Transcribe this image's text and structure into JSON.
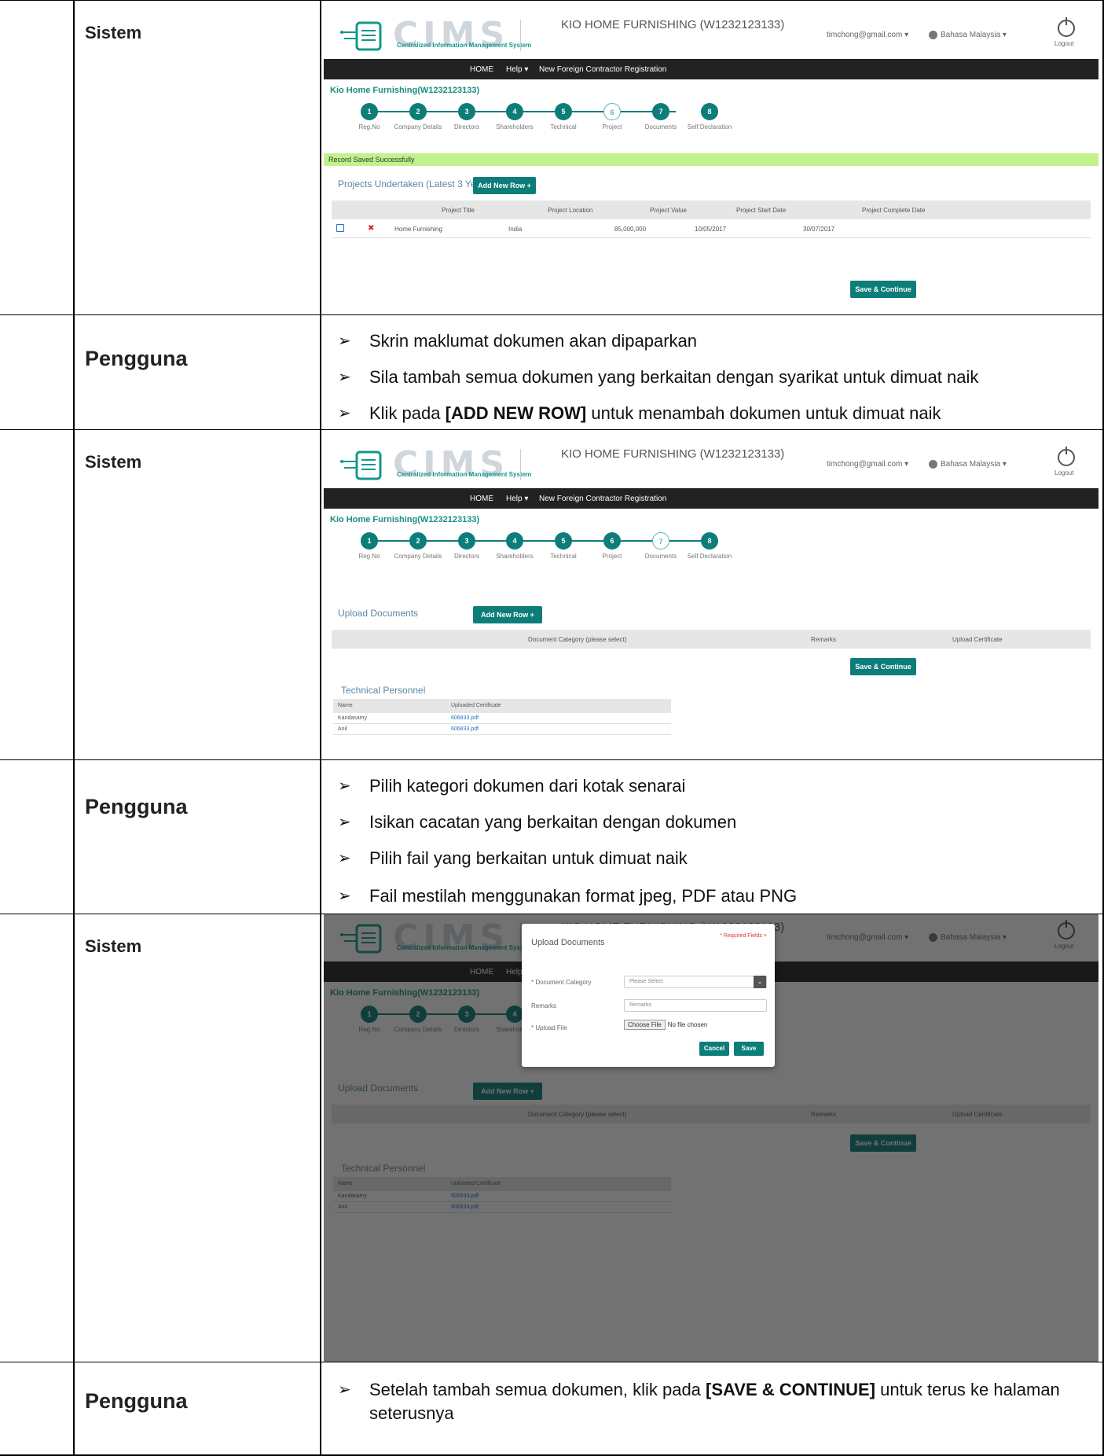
{
  "roles": {
    "sistem": "Sistem",
    "pengguna": "Pengguna"
  },
  "cims": {
    "logo_text": "CIMS",
    "logo_subtitle": "Centralized Information Management System",
    "company": "KIO HOME FURNISHING (W1232123133)",
    "email": "timchong@gmail.com ▾",
    "language": "Bahasa Malaysia ▾",
    "logout": "Logout",
    "nav": {
      "home": "HOME",
      "help": "Help ▾",
      "registration": "New Foreign Contractor Registration"
    },
    "company_name": "Kio Home Furnishing(W1232123133)",
    "steps": [
      {
        "num": "1",
        "label": "Reg.No"
      },
      {
        "num": "2",
        "label": "Company Details"
      },
      {
        "num": "3",
        "label": "Directors"
      },
      {
        "num": "4",
        "label": "Shareholders"
      },
      {
        "num": "5",
        "label": "Technical"
      },
      {
        "num": "6",
        "label": "Project"
      },
      {
        "num": "7",
        "label": "Documents"
      },
      {
        "num": "8",
        "label": "Self Declaration"
      }
    ]
  },
  "screen1": {
    "saved_msg": "Record Saved Successfully",
    "section_title": "Projects Undertaken (Latest 3 Years)",
    "add_button": "Add New Row +",
    "headers": [
      "Project Title",
      "Project Location",
      "Project Value",
      "Project Start Date",
      "Project Complete Date"
    ],
    "row": {
      "title": "Home Furnishing",
      "location": "India",
      "value": "85,000,000",
      "start": "10/05/2017",
      "complete": "30/07/2017",
      "delete": "✖"
    },
    "save_button": "Save & Continue"
  },
  "screen2": {
    "section_title": "Upload Documents",
    "add_button": "Add New Row +",
    "headers": [
      "Document Category (please select)",
      "Remarks",
      "Upload Certificate"
    ],
    "save_button": "Save & Continue",
    "tech_title": "Technical Personnel",
    "tech_headers": [
      "Name",
      "Uploaded Certificate"
    ],
    "tech_rows": [
      {
        "name": "Kandasamy",
        "file": "606833.pdf"
      },
      {
        "name": "Anil",
        "file": "606833.pdf"
      }
    ]
  },
  "modal": {
    "title": "Upload Documents",
    "required": "* Required Fields ×",
    "category_label": "Document Category",
    "category_value": "Please Select",
    "remarks_label": "Remarks",
    "remarks_placeholder": "Remarks",
    "file_label": "Upload File",
    "choose_file": "Choose File",
    "no_file": "No file chosen",
    "cancel": "Cancel",
    "save": "Save"
  },
  "instructions1": [
    "Skrin maklumat dokumen akan dipaparkan",
    "Sila tambah semua dokumen yang berkaitan dengan syarikat untuk dimuat naik"
  ],
  "instructions1_last": {
    "pre": "Klik pada ",
    "bold": "[ADD NEW ROW]",
    "post": " untuk menambah dokumen untuk dimuat naik"
  },
  "instructions2": [
    "Pilih kategori dokumen dari kotak senarai",
    "Isikan cacatan yang berkaitan dengan dokumen",
    "Pilih fail yang berkaitan untuk dimuat naik",
    "Fail mestilah menggunakan format jpeg, PDF atau PNG"
  ],
  "instructions3": {
    "pre": "Setelah tambah semua dokumen, klik pada ",
    "bold": "[SAVE & CONTINUE]",
    "post": " untuk terus ke halaman seterusnya"
  }
}
